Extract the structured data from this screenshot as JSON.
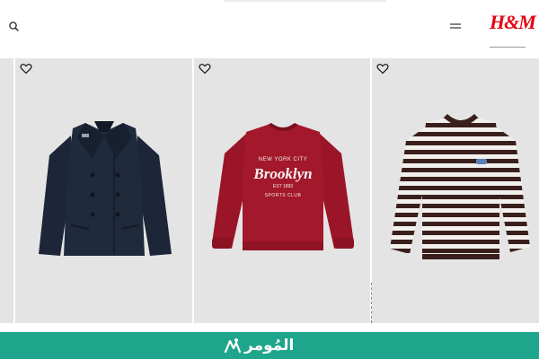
{
  "header": {
    "logo_text": "H&M",
    "icons": {
      "search": "search-icon",
      "menu": "hamburger-menu-icon"
    }
  },
  "products": [
    {
      "name": "partial-product",
      "image": "partial-product-image"
    },
    {
      "name": "navy-double-breasted-coat",
      "image": "navy-coat-image",
      "favorite_icon": "heart-icon"
    },
    {
      "name": "red-brooklyn-sweatshirt",
      "image": "brooklyn-sweatshirt-image",
      "favorite_icon": "heart-icon",
      "print": {
        "line1": "NEW YORK CITY",
        "line2": "Brooklyn",
        "line3": "EST 1893",
        "line4": "SPORTS CLUB"
      }
    },
    {
      "name": "striped-long-sleeve-top",
      "image": "striped-top-image",
      "favorite_icon": "heart-icon"
    }
  ],
  "brand_banner": {
    "text": "المُومر",
    "color": "#1fa58c"
  },
  "colors": {
    "logo_red": "#e50010",
    "card_bg": "#e4e4e4",
    "coat_navy": "#1c2638",
    "sweatshirt_red": "#a3182a",
    "stripe_brown": "#3a1f1c"
  }
}
